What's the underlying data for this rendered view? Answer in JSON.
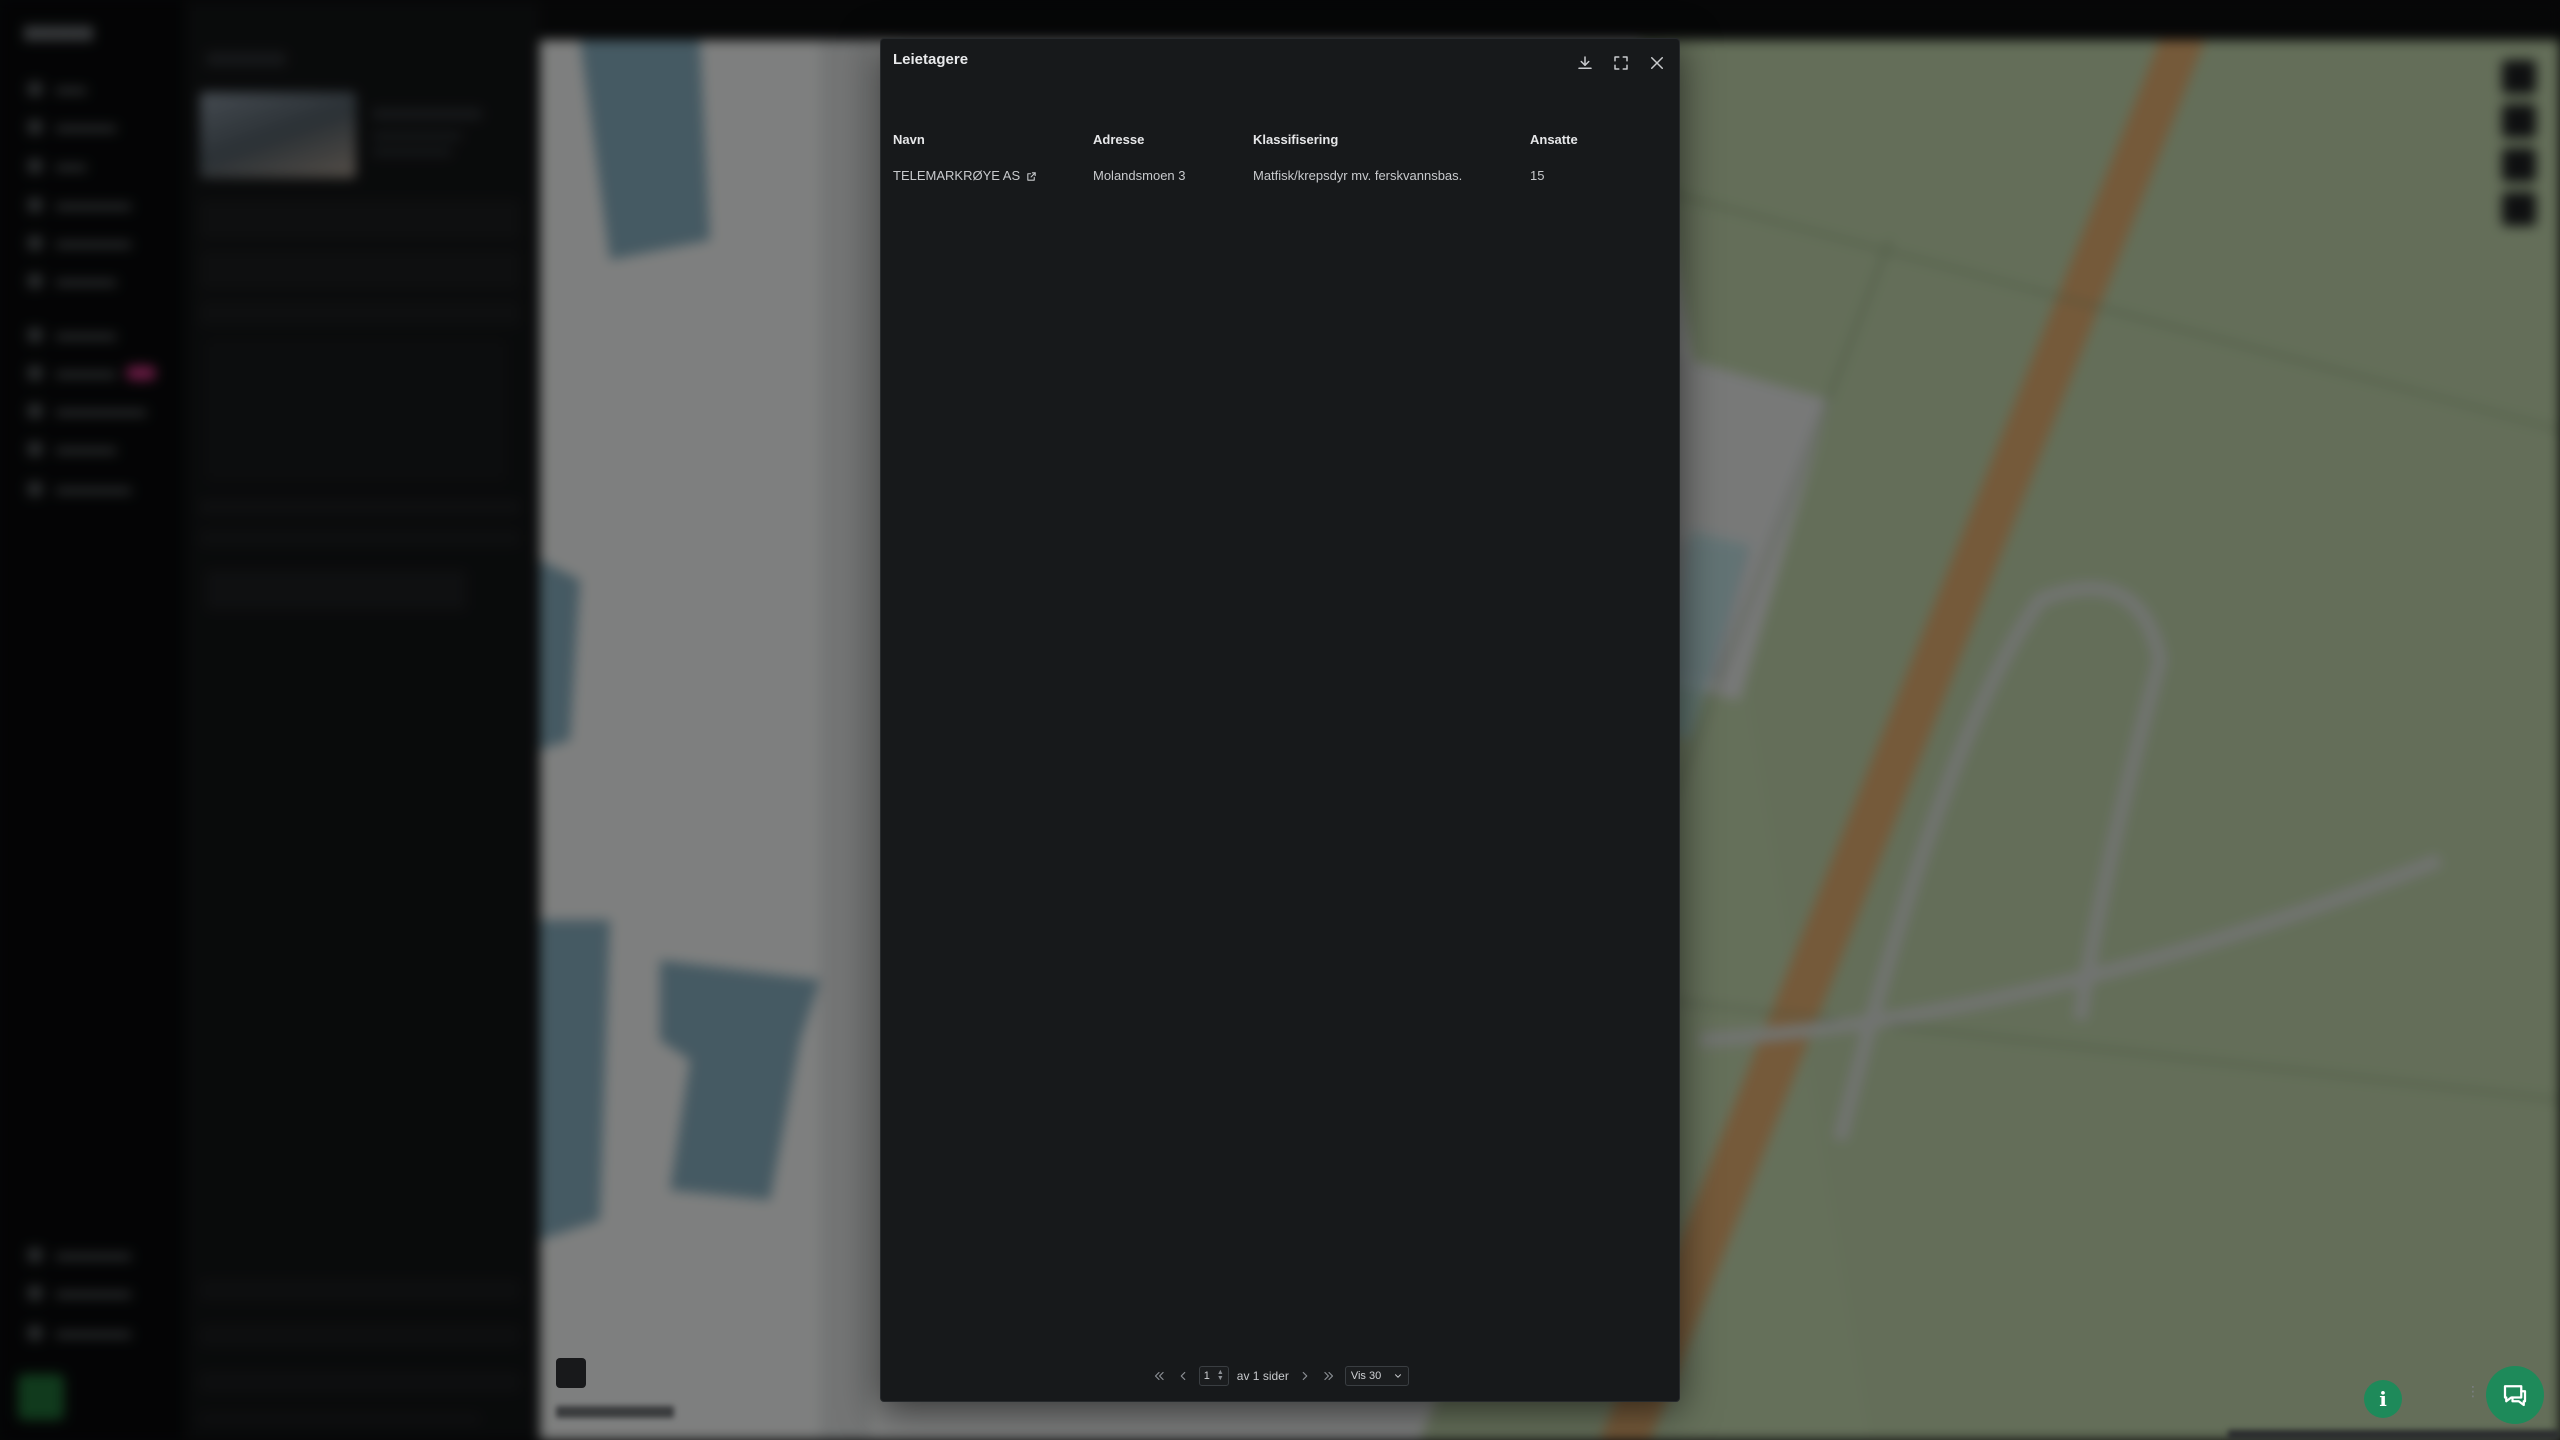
{
  "modal": {
    "title": "Leietagere",
    "actions": {
      "download": "download-icon",
      "fullscreen": "expand-icon",
      "close": "close-icon"
    },
    "columns": [
      "Navn",
      "Adresse",
      "Klassifisering",
      "Ansatte"
    ],
    "rows": [
      {
        "navn": "TELEMARKRØYE AS",
        "adresse": "Molandsmoen 3",
        "klassifisering": "Matfisk/krepsdyr mv. ferskvannsbas.",
        "ansatte": "15"
      }
    ],
    "pagination": {
      "current_page": "1",
      "of_pages_text": "av 1 sider",
      "page_size_label": "Vis 30"
    }
  },
  "colors": {
    "modal_bg": "#17191b",
    "accent_green": "#1e8a5a",
    "map_green": "#b6c9a2",
    "road_orange": "#d6a46a",
    "building_blue": "#7fa4b4"
  }
}
